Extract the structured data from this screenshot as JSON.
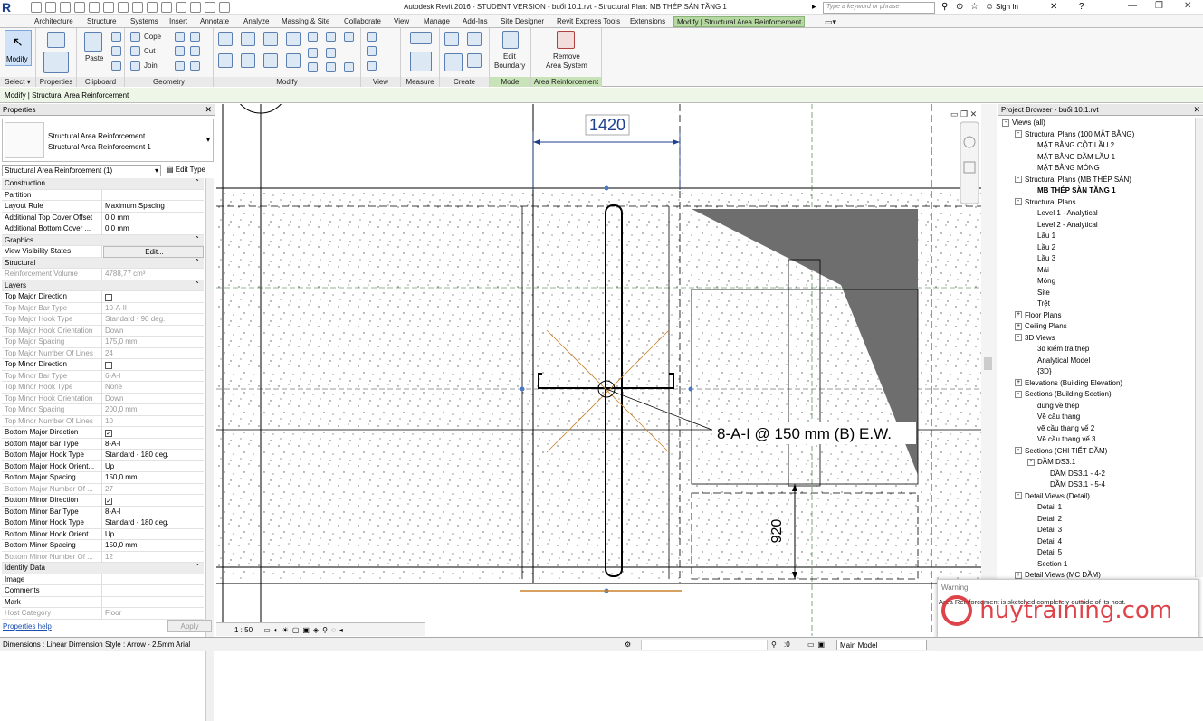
{
  "title": "Autodesk Revit 2016 - STUDENT VERSION -    buổi 10.1.rvt - Structural Plan: MB THÉP SÀN TẦNG 1",
  "search_placeholder": "Type a keyword or phrase",
  "signin": "Sign In",
  "tabs": [
    "Architecture",
    "Structure",
    "Systems",
    "Insert",
    "Annotate",
    "Analyze",
    "Massing & Site",
    "Collaborate",
    "View",
    "Manage",
    "Add-Ins",
    "Site Designer",
    "Revit Express Tools",
    "Extensions",
    "Modify | Structural Area Reinforcement"
  ],
  "ribbon": {
    "modify_label": "Modify",
    "paste_label": "Paste",
    "cope_label": "Cope",
    "cut_label": "Cut",
    "join_label": "Join",
    "edit_boundary_l1": "Edit",
    "edit_boundary_l2": "Boundary",
    "remove_l1": "Remove",
    "remove_l2": "Area System",
    "groups": {
      "select": "Select",
      "properties": "Properties",
      "clipboard": "Clipboard",
      "geometry": "Geometry",
      "modify": "Modify",
      "view": "View",
      "measure": "Measure",
      "create": "Create",
      "mode": "Mode",
      "area_reinf": "Area Reinforcement"
    }
  },
  "context_bar": "Modify | Structural Area Reinforcement",
  "properties": {
    "header": "Properties",
    "type_name_1": "Structural Area Reinforcement",
    "type_name_2": "Structural Area Reinforcement 1",
    "instance_selector": "Structural Area Reinforcement (1)",
    "edit_type": "Edit Type",
    "help": "Properties help",
    "apply": "Apply",
    "rows": [
      {
        "k": "Construction",
        "sect": true
      },
      {
        "k": "Partition",
        "v": ""
      },
      {
        "k": "Layout Rule",
        "v": "Maximum Spacing"
      },
      {
        "k": "Additional Top Cover Offset",
        "v": "0,0 mm"
      },
      {
        "k": "Additional Bottom Cover ...",
        "v": "0,0 mm"
      },
      {
        "k": "Graphics",
        "sect": true
      },
      {
        "k": "View Visibility States",
        "v": "Edit..."
      },
      {
        "k": "Structural",
        "sect": true
      },
      {
        "k": "Reinforcement Volume",
        "v": "4788,77 cm³",
        "gray": true
      },
      {
        "k": "Layers",
        "sect": true
      },
      {
        "k": "Top Major Direction",
        "cb": ""
      },
      {
        "k": "Top Major Bar Type",
        "v": "10-A-II",
        "gray": true
      },
      {
        "k": "Top Major Hook Type",
        "v": "Standard - 90 deg.",
        "gray": true
      },
      {
        "k": "Top Major Hook Orientation",
        "v": "Down",
        "gray": true
      },
      {
        "k": "Top Major Spacing",
        "v": "175,0 mm",
        "gray": true
      },
      {
        "k": "Top Major Number Of Lines",
        "v": "24",
        "gray": true
      },
      {
        "k": "Top Minor Direction",
        "cb": ""
      },
      {
        "k": "Top Minor Bar Type",
        "v": "6-A-I",
        "gray": true
      },
      {
        "k": "Top Minor Hook Type",
        "v": "None",
        "gray": true
      },
      {
        "k": "Top Minor Hook Orientation",
        "v": "Down",
        "gray": true
      },
      {
        "k": "Top Minor Spacing",
        "v": "200,0 mm",
        "gray": true
      },
      {
        "k": "Top Minor Number Of Lines",
        "v": "10",
        "gray": true
      },
      {
        "k": "Bottom Major Direction",
        "cb": "✓"
      },
      {
        "k": "Bottom Major Bar Type",
        "v": "8-A-I"
      },
      {
        "k": "Bottom Major Hook Type",
        "v": "Standard - 180 deg."
      },
      {
        "k": "Bottom Major Hook Orient...",
        "v": "Up"
      },
      {
        "k": "Bottom Major Spacing",
        "v": "150,0 mm"
      },
      {
        "k": "Bottom Major Number Of ...",
        "v": "27",
        "gray": true
      },
      {
        "k": "Bottom Minor Direction",
        "cb": "✓"
      },
      {
        "k": "Bottom Minor Bar Type",
        "v": "8-A-I"
      },
      {
        "k": "Bottom Minor Hook Type",
        "v": "Standard - 180 deg."
      },
      {
        "k": "Bottom Minor Hook Orient...",
        "v": "Up"
      },
      {
        "k": "Bottom Minor Spacing",
        "v": "150,0 mm"
      },
      {
        "k": "Bottom Minor Number Of ...",
        "v": "12",
        "gray": true
      },
      {
        "k": "Identity Data",
        "sect": true
      },
      {
        "k": "Image",
        "v": ""
      },
      {
        "k": "Comments",
        "v": ""
      },
      {
        "k": "Mark",
        "v": ""
      },
      {
        "k": "Host Category",
        "v": "Floor",
        "gray": true
      }
    ]
  },
  "canvas": {
    "dim_top": "1420",
    "dim_side": "920",
    "tag": "8-A-I @ 150 mm (B) E.W."
  },
  "browser": {
    "header": "Project Browser - buổi 10.1.rvt",
    "items": [
      {
        "t": "Views (all)",
        "lvl": 0,
        "tog": "-"
      },
      {
        "t": "Structural Plans (100 MẶT BẰNG)",
        "lvl": 1,
        "tog": "-"
      },
      {
        "t": "MẶT BẰNG CỘT LẦU 2",
        "lvl": 2
      },
      {
        "t": "MẶT BẰNG DẦM LẦU 1",
        "lvl": 2
      },
      {
        "t": "MẶT BẰNG MÓNG",
        "lvl": 2
      },
      {
        "t": "Structural Plans (MB THÉP SÀN)",
        "lvl": 1,
        "tog": "-"
      },
      {
        "t": "MB THÉP SÀN TẦNG 1",
        "lvl": 2,
        "bold": true
      },
      {
        "t": "Structural Plans",
        "lvl": 1,
        "tog": "-"
      },
      {
        "t": "Level 1 - Analytical",
        "lvl": 2
      },
      {
        "t": "Level 2 - Analytical",
        "lvl": 2
      },
      {
        "t": "Lầu 1",
        "lvl": 2
      },
      {
        "t": "Lầu 2",
        "lvl": 2
      },
      {
        "t": "Lầu 3",
        "lvl": 2
      },
      {
        "t": "Mái",
        "lvl": 2
      },
      {
        "t": "Móng",
        "lvl": 2
      },
      {
        "t": "Site",
        "lvl": 2
      },
      {
        "t": "Trệt",
        "lvl": 2
      },
      {
        "t": "Floor Plans",
        "lvl": 1,
        "tog": "+"
      },
      {
        "t": "Ceiling Plans",
        "lvl": 1,
        "tog": "+"
      },
      {
        "t": "3D Views",
        "lvl": 1,
        "tog": "-"
      },
      {
        "t": "3d kiểm tra thép",
        "lvl": 2
      },
      {
        "t": "Analytical Model",
        "lvl": 2
      },
      {
        "t": "{3D}",
        "lvl": 2
      },
      {
        "t": "Elevations (Building Elevation)",
        "lvl": 1,
        "tog": "+"
      },
      {
        "t": "Sections (Building Section)",
        "lvl": 1,
        "tog": "-"
      },
      {
        "t": "dùng về thép",
        "lvl": 2
      },
      {
        "t": "Vẽ cầu thang",
        "lvl": 2
      },
      {
        "t": "vẽ cầu thang vế 2",
        "lvl": 2
      },
      {
        "t": "Vẽ cầu thang vế 3",
        "lvl": 2
      },
      {
        "t": "Sections (CHI TIẾT DẦM)",
        "lvl": 1,
        "tog": "-"
      },
      {
        "t": "DẦM DS3.1",
        "lvl": 2,
        "tog": "-"
      },
      {
        "t": "DẦM DS3.1 - 4-2",
        "lvl": 3
      },
      {
        "t": "DẦM DS3.1 - 5-4",
        "lvl": 3
      },
      {
        "t": "Detail Views (Detail)",
        "lvl": 1,
        "tog": "-"
      },
      {
        "t": "Detail 1",
        "lvl": 2
      },
      {
        "t": "Detail 2",
        "lvl": 2
      },
      {
        "t": "Detail 3",
        "lvl": 2
      },
      {
        "t": "Detail 4",
        "lvl": 2
      },
      {
        "t": "Detail 5",
        "lvl": 2
      },
      {
        "t": "Section 1",
        "lvl": 2
      },
      {
        "t": "Detail Views (MC DẦM)",
        "lvl": 1,
        "tog": "+"
      }
    ]
  },
  "warning": {
    "head": "Warning",
    "msg": "Area Reinforcement is sketched completely outside of its host."
  },
  "watermark": "huytraining.com",
  "viewbar_scale": "1 : 50",
  "statusbar": {
    "text": "Dimensions : Linear Dimension Style : Arrow - 2.5mm Arial",
    "zero": ":0",
    "model": "Main Model"
  }
}
